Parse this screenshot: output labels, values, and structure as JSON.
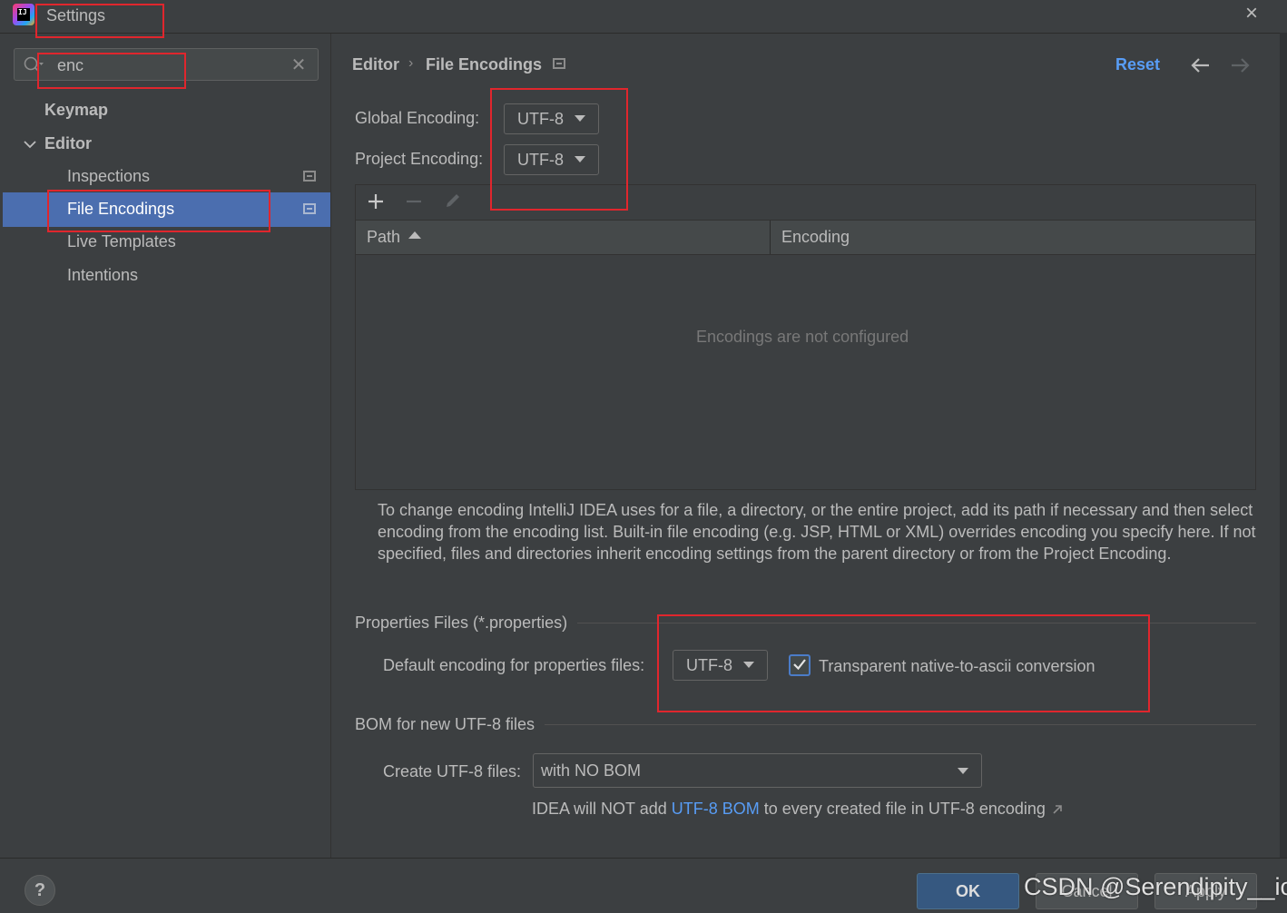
{
  "window": {
    "title": "Settings"
  },
  "search": {
    "value": "enc"
  },
  "sidebar": {
    "items": [
      {
        "label": "Keymap"
      },
      {
        "label": "Editor"
      },
      {
        "label": "Inspections"
      },
      {
        "label": "File Encodings"
      },
      {
        "label": "Live Templates"
      },
      {
        "label": "Intentions"
      }
    ]
  },
  "breadcrumb": {
    "parent": "Editor",
    "separator": "›",
    "current": "File Encodings"
  },
  "header": {
    "reset_label": "Reset"
  },
  "encoding": {
    "global_label": "Global Encoding:",
    "global_value": "UTF-8",
    "project_label": "Project Encoding:",
    "project_value": "UTF-8"
  },
  "table": {
    "columns": [
      "Path",
      "Encoding"
    ],
    "empty_text": "Encodings are not configured"
  },
  "help_text": "To change encoding IntelliJ IDEA uses for a file, a directory, or the entire project, add its path if necessary and then select encoding from the encoding list. Built-in file encoding (e.g. JSP, HTML or XML) overrides encoding you specify here. If not specified, files and directories inherit encoding settings from the parent directory or from the Project Encoding.",
  "properties": {
    "section_title": "Properties Files (*.properties)",
    "default_label": "Default encoding for properties files:",
    "default_value": "UTF-8",
    "checkbox_label": "Transparent native-to-ascii conversion",
    "checkbox_checked": true
  },
  "bom": {
    "section_title": "BOM for new UTF-8 files",
    "create_label": "Create UTF-8 files:",
    "create_value": "with NO BOM",
    "note_prefix": "IDEA will NOT add ",
    "note_link": "UTF-8 BOM",
    "note_suffix": " to every created file in UTF-8 encoding"
  },
  "footer": {
    "help_label": "?",
    "ok_label": "OK",
    "cancel_label": "Cancel",
    "apply_label": "Apply"
  },
  "watermark": "CSDN @Serendipity__io",
  "colors": {
    "background": "#3c3f41",
    "selection": "#4b6eaf",
    "link": "#589df6",
    "annotation": "#e0262d"
  }
}
